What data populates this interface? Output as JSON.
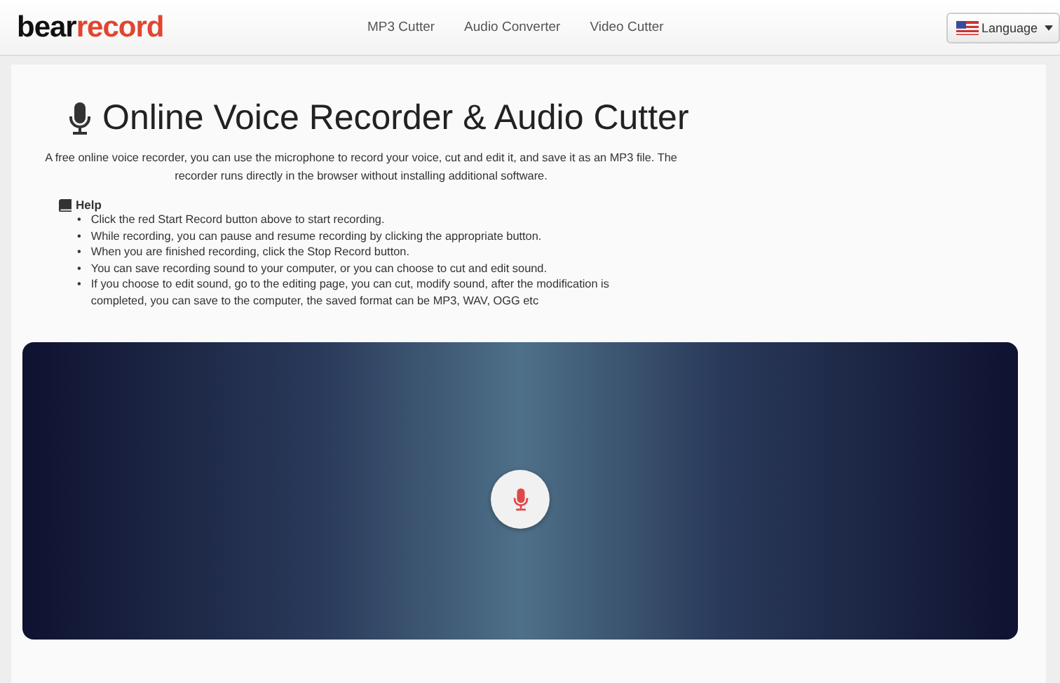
{
  "logo": {
    "parts": [
      {
        "text": "bear",
        "kind": "dark"
      },
      {
        "text": "record",
        "kind": "accent"
      }
    ]
  },
  "nav": [
    {
      "label": "MP3 Cutter"
    },
    {
      "label": "Audio Converter"
    },
    {
      "label": "Video Cutter"
    }
  ],
  "language_button": {
    "label": "Language"
  },
  "title": "Online Voice Recorder & Audio Cutter",
  "description": "A free online voice recorder, you can use the microphone to record your voice, cut and edit it, and save it as an MP3 file. The recorder runs directly in the browser without installing additional software.",
  "help": {
    "heading": "Help",
    "items": [
      {
        "marker": "•",
        "text": "Click the red Start Record button above to start recording."
      },
      {
        "marker": "•",
        "text": "While recording, you can pause and resume recording by clicking the appropriate button."
      },
      {
        "marker": "•",
        "text": "When you are finished recording, click the Stop Record button."
      },
      {
        "marker": "•",
        "text": "You can save recording sound to your computer, or you can choose to cut and edit sound."
      },
      {
        "marker": "•",
        "text": "If you choose to edit sound, go to the editing page, you can cut, modify sound, after the modification is completed, you can save to the computer, the saved format can be MP3, WAV, OGG etc"
      }
    ]
  }
}
